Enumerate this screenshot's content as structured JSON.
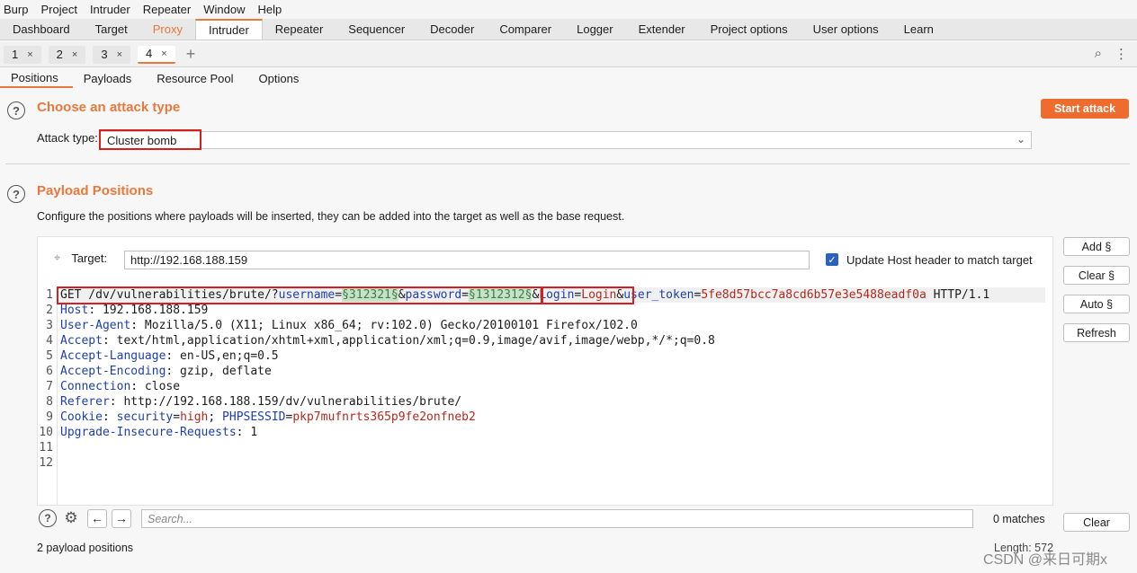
{
  "menu": [
    "Burp",
    "Project",
    "Intruder",
    "Repeater",
    "Window",
    "Help"
  ],
  "main_tabs": [
    {
      "label": "Dashboard",
      "state": "normal"
    },
    {
      "label": "Target",
      "state": "normal"
    },
    {
      "label": "Proxy",
      "state": "orange"
    },
    {
      "label": "Intruder",
      "state": "active"
    },
    {
      "label": "Repeater",
      "state": "normal"
    },
    {
      "label": "Sequencer",
      "state": "normal"
    },
    {
      "label": "Decoder",
      "state": "normal"
    },
    {
      "label": "Comparer",
      "state": "normal"
    },
    {
      "label": "Logger",
      "state": "normal"
    },
    {
      "label": "Extender",
      "state": "normal"
    },
    {
      "label": "Project options",
      "state": "normal"
    },
    {
      "label": "User options",
      "state": "normal"
    },
    {
      "label": "Learn",
      "state": "normal"
    }
  ],
  "attack_tabs": [
    "1",
    "2",
    "3",
    "4"
  ],
  "attack_tabs_close": "×",
  "attack_tab_add": "+",
  "section_tabs": [
    "Positions",
    "Payloads",
    "Resource Pool",
    "Options"
  ],
  "attack_type_section": {
    "title": "Choose an attack type",
    "label": "Attack type:",
    "value": "Cluster bomb",
    "start_button": "Start attack"
  },
  "payload_section": {
    "title": "Payload Positions",
    "description": "Configure the positions where payloads will be inserted, they can be added into the target as well as the base request.",
    "target_label": "Target:",
    "target_value": "http://192.168.188.159",
    "update_host_label": "Update Host header to match target",
    "update_host_checked": true
  },
  "side_buttons": [
    "Add §",
    "Clear §",
    "Auto §",
    "Refresh"
  ],
  "request_lines": [
    [
      "1",
      [
        [
          "t",
          "GET /dv/vulnerabilities/brute/?"
        ],
        [
          "b",
          "username"
        ],
        [
          "t",
          "="
        ],
        [
          "p",
          "§312321§"
        ],
        [
          "t",
          "&"
        ],
        [
          "b",
          "password"
        ],
        [
          "t",
          "="
        ],
        [
          "p",
          "§1312312§"
        ],
        [
          "t",
          "&"
        ],
        [
          "b",
          "Login"
        ],
        [
          "t",
          "="
        ],
        [
          "r",
          "Login"
        ],
        [
          "t",
          "&"
        ],
        [
          "b",
          "user_token"
        ],
        [
          "t",
          "="
        ],
        [
          "r",
          "5fe8d57bcc7a8cd6b57e3e5488eadf0a"
        ],
        [
          "t",
          " HTTP/1.1"
        ]
      ]
    ],
    [
      "2",
      [
        [
          "b",
          "Host"
        ],
        [
          "t",
          ": 192.168.188.159"
        ]
      ]
    ],
    [
      "3",
      [
        [
          "b",
          "User-Agent"
        ],
        [
          "t",
          ": Mozilla/5.0 (X11; Linux x86_64; rv:102.0) Gecko/20100101 Firefox/102.0"
        ]
      ]
    ],
    [
      "4",
      [
        [
          "b",
          "Accept"
        ],
        [
          "t",
          ": text/html,application/xhtml+xml,application/xml;q=0.9,image/avif,image/webp,*/*;q=0.8"
        ]
      ]
    ],
    [
      "5",
      [
        [
          "b",
          "Accept-Language"
        ],
        [
          "t",
          ": en-US,en;q=0.5"
        ]
      ]
    ],
    [
      "6",
      [
        [
          "b",
          "Accept-Encoding"
        ],
        [
          "t",
          ": gzip, deflate"
        ]
      ]
    ],
    [
      "7",
      [
        [
          "b",
          "Connection"
        ],
        [
          "t",
          ": close"
        ]
      ]
    ],
    [
      "8",
      [
        [
          "b",
          "Referer"
        ],
        [
          "t",
          ": http://192.168.188.159/dv/vulnerabilities/brute/"
        ]
      ]
    ],
    [
      "9",
      [
        [
          "b",
          "Cookie"
        ],
        [
          "t",
          ": "
        ],
        [
          "b",
          "security"
        ],
        [
          "t",
          "="
        ],
        [
          "r",
          "high"
        ],
        [
          "t",
          "; "
        ],
        [
          "b",
          "PHPSESSID"
        ],
        [
          "t",
          "="
        ],
        [
          "r",
          "pkp7mufnrts365p9fe2onfneb2"
        ]
      ]
    ],
    [
      "10",
      [
        [
          "b",
          "Upgrade-Insecure-Requests"
        ],
        [
          "t",
          ": 1"
        ]
      ]
    ],
    [
      "11",
      []
    ],
    [
      "12",
      []
    ]
  ],
  "search": {
    "placeholder": "Search...",
    "matches": "0 matches",
    "clear_label": "Clear"
  },
  "status": {
    "payload_positions": "2 payload positions",
    "length": "Length: 572"
  },
  "watermark": "CSDN @来日可期x",
  "help_glyph": "?",
  "colors": {
    "accent": "#e8783c",
    "highlight_box": "#d61f1f",
    "payload_bg": "#c6e2c8"
  }
}
